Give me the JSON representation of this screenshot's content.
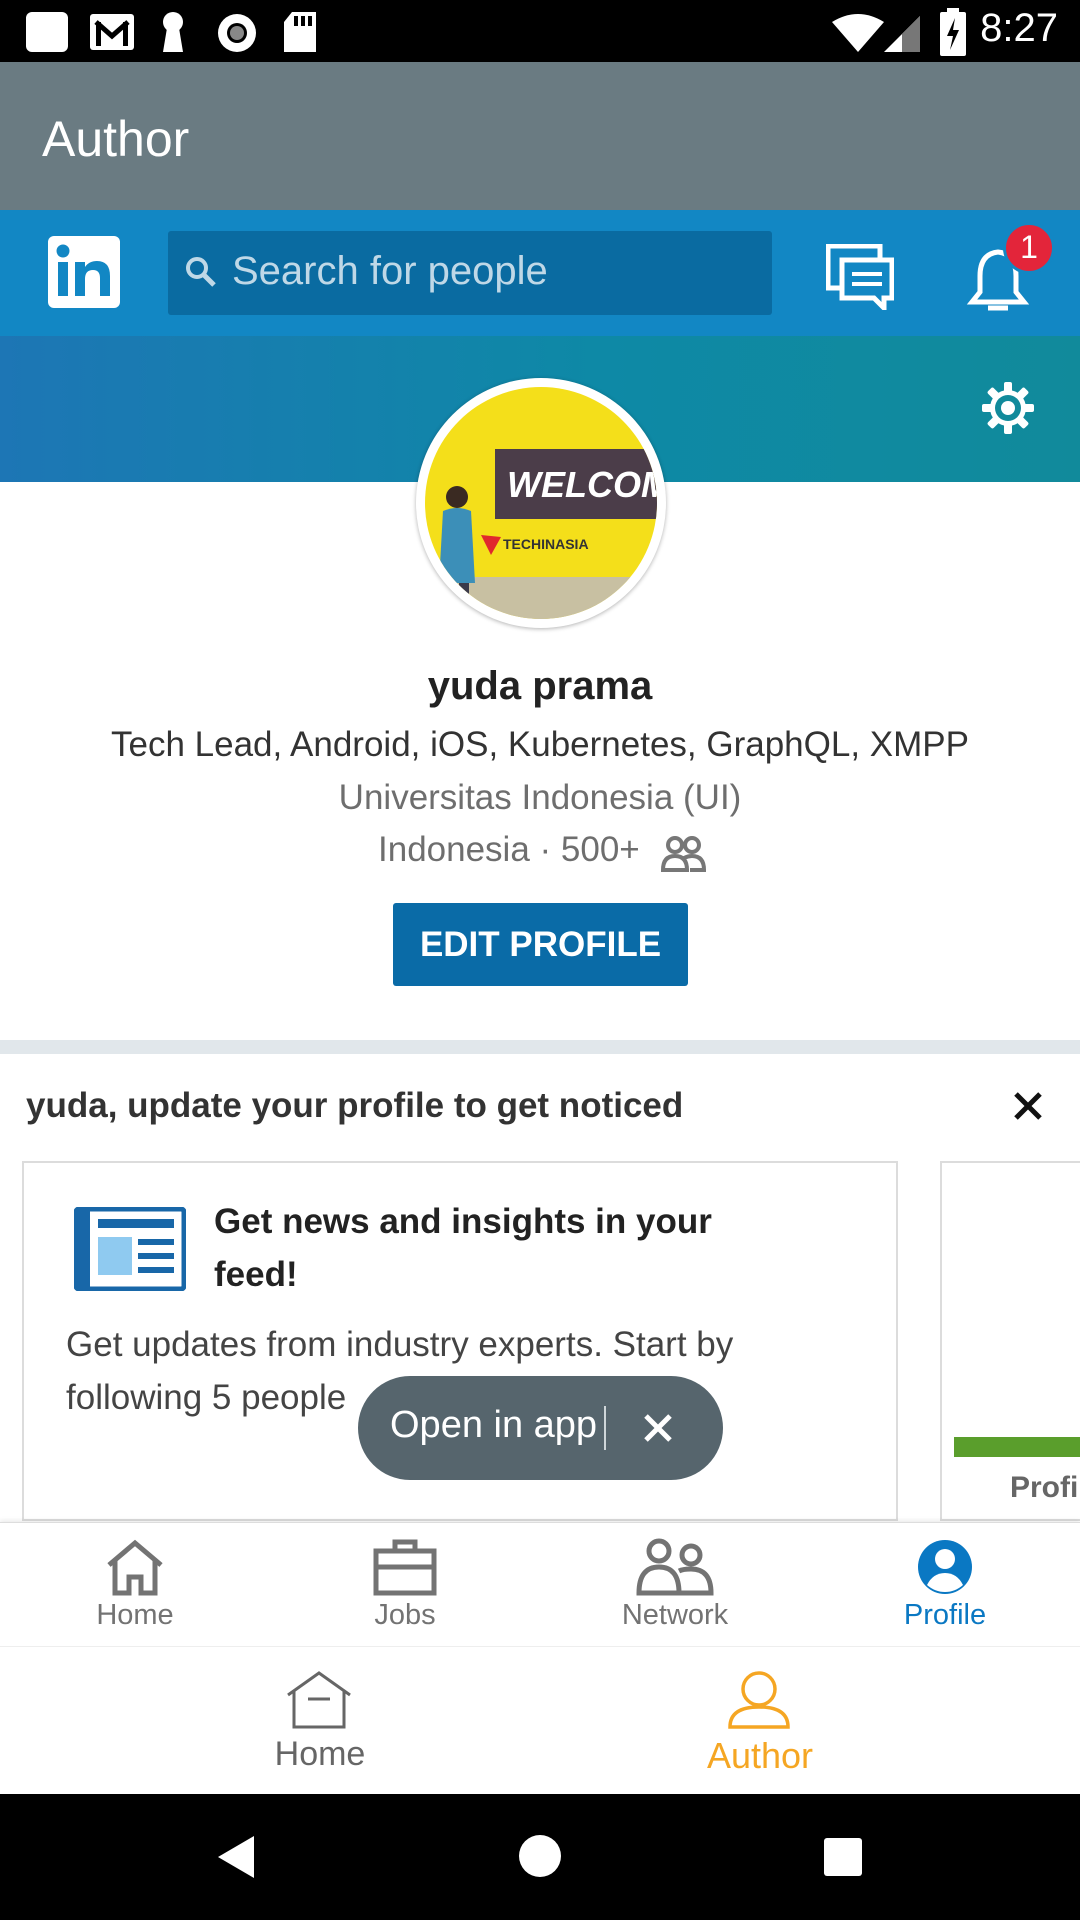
{
  "status_bar": {
    "time": "8:27",
    "icons": [
      "app-icon",
      "gmail-icon",
      "keyhole-icon",
      "record-icon",
      "sd-card-icon",
      "wifi-icon",
      "signal-icon",
      "battery-charging-icon"
    ]
  },
  "app_bar": {
    "title": "Author"
  },
  "linkedin_header": {
    "logo_text": "in",
    "search_placeholder": "Search for people",
    "notification_count": "1"
  },
  "profile": {
    "name": "yuda prama",
    "headline": "Tech Lead, Android, iOS, Kubernetes, GraphQL, XMPP",
    "school": "Universitas Indonesia (UI)",
    "location": "Indonesia · 500+",
    "edit_label": "EDIT PROFILE",
    "avatar_sign_text": "WELCOM",
    "avatar_sub_text": "TECHINASIA"
  },
  "suggestions": {
    "title": "yuda, update your profile to get noticed",
    "card_title": "Get news and insights in your feed!",
    "card_desc": "Get updates from industry experts. Start by following 5 people",
    "side_card_label": "Profil"
  },
  "open_in_app": {
    "label": "Open in app"
  },
  "linkedin_nav": {
    "items": [
      {
        "label": "Home",
        "icon": "home-icon"
      },
      {
        "label": "Jobs",
        "icon": "briefcase-icon"
      },
      {
        "label": "Network",
        "icon": "network-icon"
      },
      {
        "label": "Profile",
        "icon": "profile-icon",
        "active": true
      }
    ]
  },
  "host_nav": {
    "items": [
      {
        "label": "Home",
        "icon": "home-icon"
      },
      {
        "label": "Author",
        "icon": "person-icon",
        "active": true
      }
    ]
  },
  "colors": {
    "linkedin_blue": "#1287c4",
    "app_bar": "#6a7b82",
    "accent_orange": "#f5a623",
    "active_blue": "#0a78c3"
  }
}
